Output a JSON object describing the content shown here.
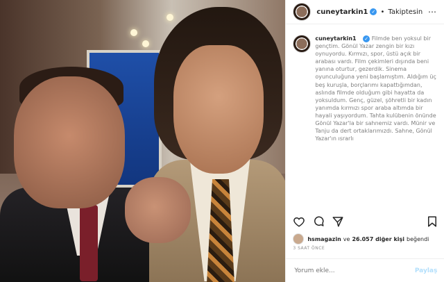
{
  "header": {
    "username": "cuneytarkin1",
    "separator": "•",
    "follow_status": "Takiptesin",
    "more": "⋯",
    "verified_icon": "✓"
  },
  "caption": {
    "username": "cuneytarkin1",
    "text": "Filmde ben yoksul bir gençtim. Gönül Yazar zengin bir kızı oynuyordu. Kırmızı, spor, üstü açık bir arabası vardı. Film çekimleri dışında beni yanına oturtur, gezerdik. Sinema oyunculuğuna yeni başlamıştım. Aldığım üç beş kuruşla, borçlarımı kapattığımdan, aslında filmde olduğum gibi hayatta da yoksuldum. Genç, güzel, şöhretli bir kadın yanımda kırmızı spor araba altımda bir hayali yaşıyordum. Tahta kulübenin önünde Gönül Yazar'la bir sahnemiz vardı. Münir ve Tanju da dert ortaklarımızdı. Sahne, Gönül Yazar'ın ısrarlı"
  },
  "likes": {
    "user": "hsmagazin",
    "connector": "ve",
    "count_text": "26.057 diğer kişi",
    "suffix": "beğendi"
  },
  "time_ago": "3 SAAT ÖNCE",
  "comment": {
    "placeholder": "Yorum ekle...",
    "post_label": "Paylaş"
  },
  "icons": [
    "heart-icon",
    "comment-icon",
    "share-icon",
    "bookmark-icon"
  ]
}
